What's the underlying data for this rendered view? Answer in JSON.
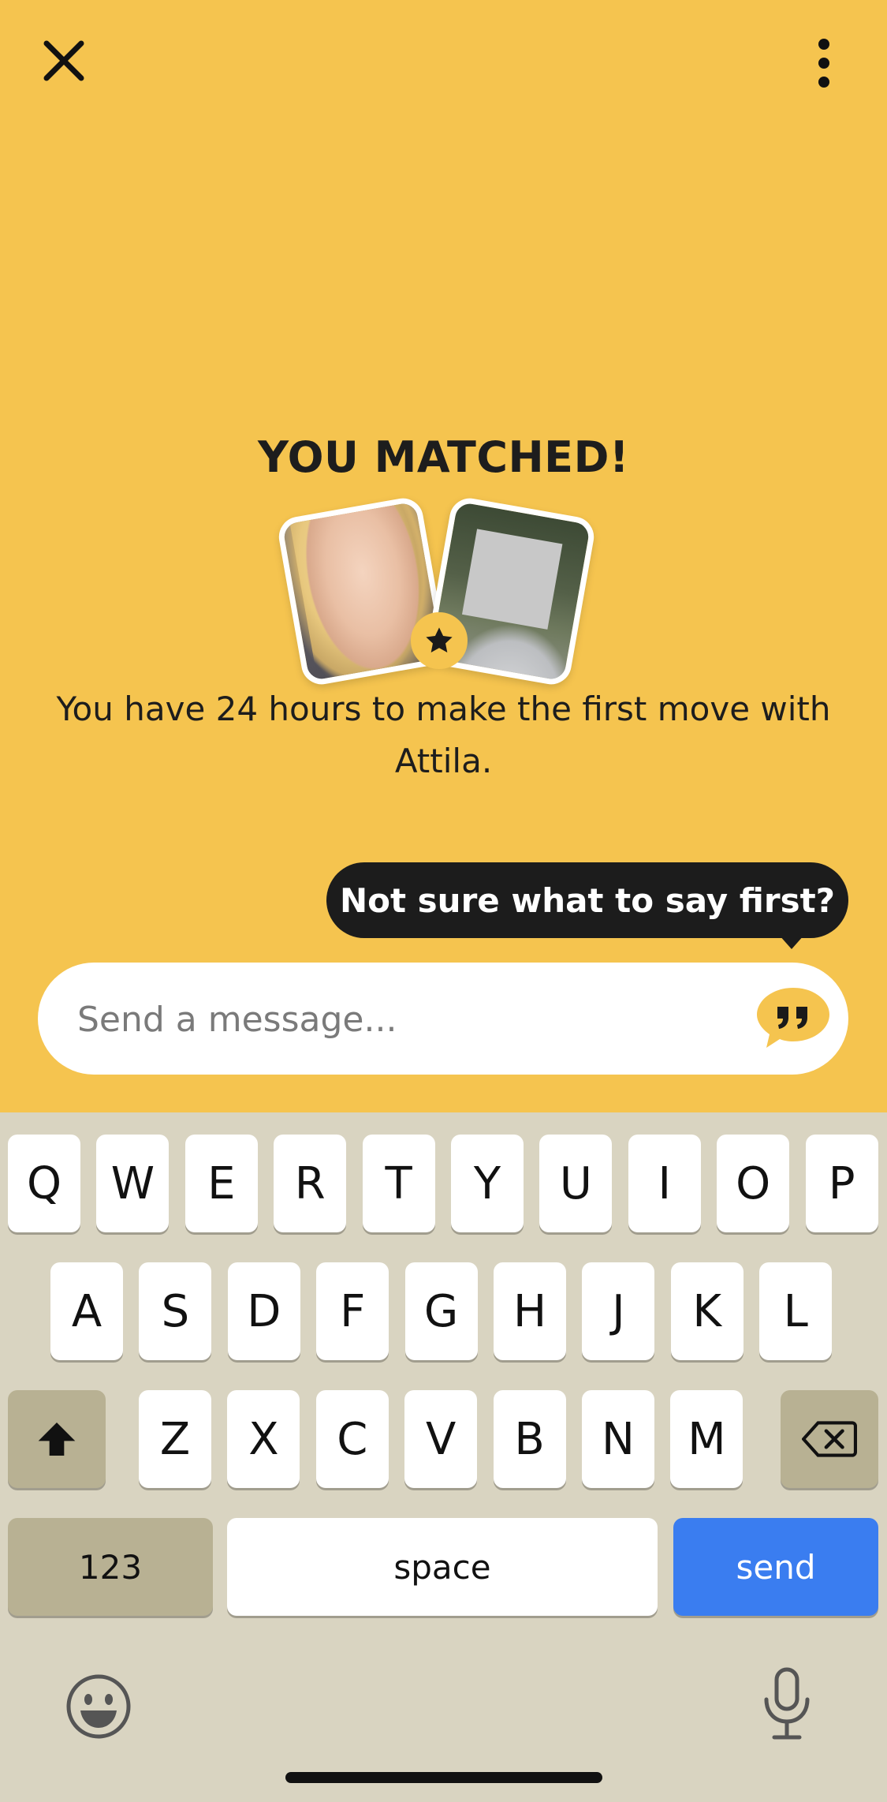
{
  "header": {
    "close_icon": "close-icon",
    "more_icon": "more-vertical-icon"
  },
  "match": {
    "title": "YOU MATCHED!",
    "subtitle": "You have 24 hours to make the first move with Attila.",
    "badge_icon": "star-icon"
  },
  "composer": {
    "tooltip": "Not sure what to say first?",
    "placeholder": "Send a message...",
    "quote_icon": "quote-bubble-icon"
  },
  "keyboard": {
    "row1": [
      "Q",
      "W",
      "E",
      "R",
      "T",
      "Y",
      "U",
      "I",
      "O",
      "P"
    ],
    "row2": [
      "A",
      "S",
      "D",
      "F",
      "G",
      "H",
      "J",
      "K",
      "L"
    ],
    "row3": [
      "Z",
      "X",
      "C",
      "V",
      "B",
      "N",
      "M"
    ],
    "numbers_label": "123",
    "space_label": "space",
    "send_label": "send",
    "shift_icon": "shift-icon",
    "backspace_icon": "backspace-icon",
    "emoji_icon": "emoji-icon",
    "mic_icon": "microphone-icon"
  },
  "colors": {
    "background": "#F5C44F",
    "keyboard": "#D9D4C1",
    "send": "#3A7DF0",
    "tooltip": "#1c1c1c"
  }
}
